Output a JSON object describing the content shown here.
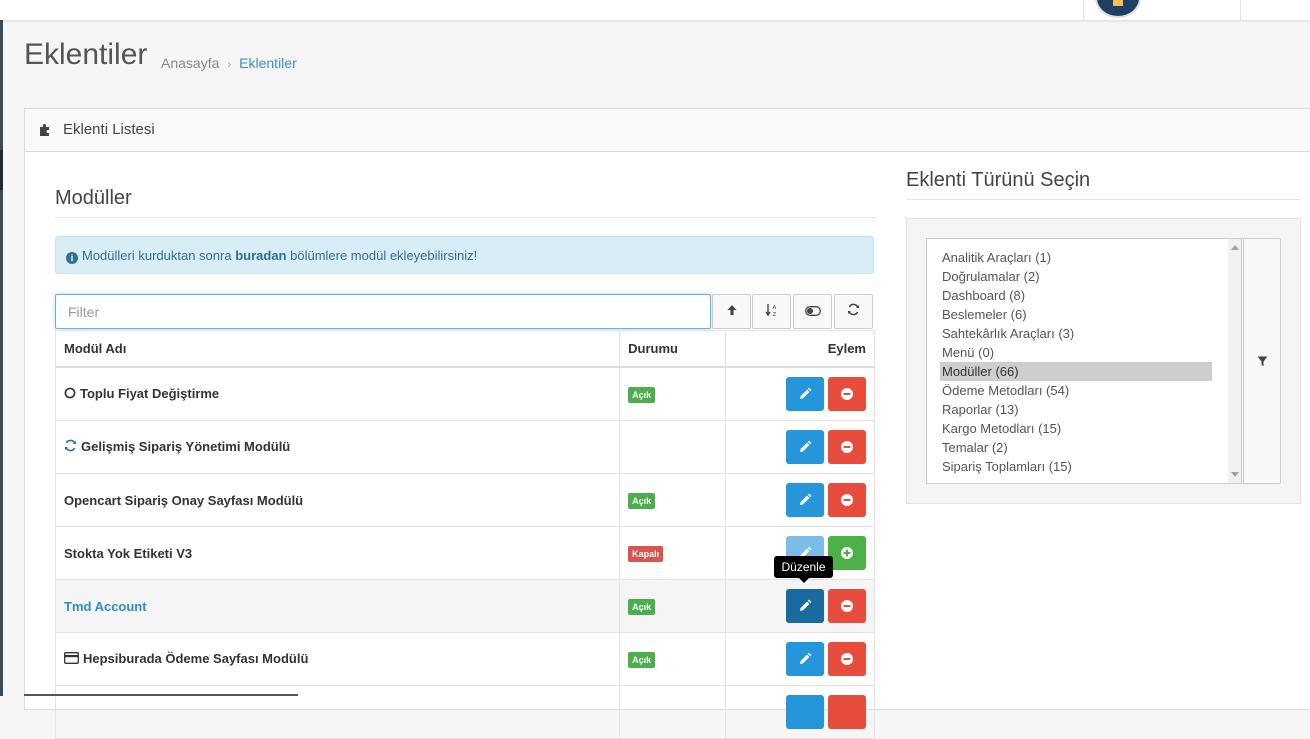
{
  "header": {
    "title": "Eklentiler"
  },
  "breadcrumb": {
    "home": "Anasayfa",
    "separator": "›",
    "current": "Eklentiler"
  },
  "panel": {
    "title": "Eklenti Listesi",
    "icon": "puzzle-icon"
  },
  "modules": {
    "title": "Modüller",
    "alert": {
      "before": "Modülleri kurduktan sonra ",
      "strong": "buradan",
      "after": " bölümlere modül ekleyebilirsiniz!"
    },
    "filter_placeholder": "Filter",
    "columns": {
      "name": "Modül Adı",
      "status": "Durumu",
      "action": "Eylem"
    },
    "rows": [
      {
        "name": "Toplu Fiyat Değiştirme",
        "icon": "circle-icon",
        "status": "Açık",
        "status_type": "on",
        "primary": "delete"
      },
      {
        "name": "Gelişmiş Sipariş Yönetimi Modülü",
        "icon": "refresh-icon",
        "status": "",
        "status_type": "none",
        "primary": "delete"
      },
      {
        "name": "Opencart Sipariş Onay Sayfası Modülü",
        "icon": "",
        "status": "Açık",
        "status_type": "on",
        "primary": "delete"
      },
      {
        "name": "Stokta Yok Etiketi V3",
        "icon": "",
        "status": "Kapalı",
        "status_type": "off",
        "primary": "install"
      },
      {
        "name": "Tmd Account",
        "icon": "",
        "status": "Açık",
        "status_type": "on",
        "primary": "delete"
      },
      {
        "name": "Hepsiburada Ödeme Sayfası Modülü",
        "icon": "credit-card-icon",
        "status": "Açık",
        "status_type": "on",
        "primary": "delete"
      }
    ],
    "tooltip": "Düzenle"
  },
  "types": {
    "title": "Eklenti Türünü Seçin",
    "options": [
      "Analitik Araçları (1)",
      "Doğrulamalar (2)",
      "Dashboard (8)",
      "Beslemeler (6)",
      "Sahtekârlık Araçları (3)",
      "Menü (0)",
      "Modüller (66)",
      "Ödeme Metodları (54)",
      "Raporlar (13)",
      "Kargo Metodları (15)",
      "Temalar (2)",
      "Sipariş Toplamları (15)"
    ],
    "selected": "Modüller (66)"
  },
  "colors": {
    "accent": "#2496d9",
    "danger": "#e74c3c",
    "success": "#4cae4c",
    "link": "#2a8ccf"
  }
}
